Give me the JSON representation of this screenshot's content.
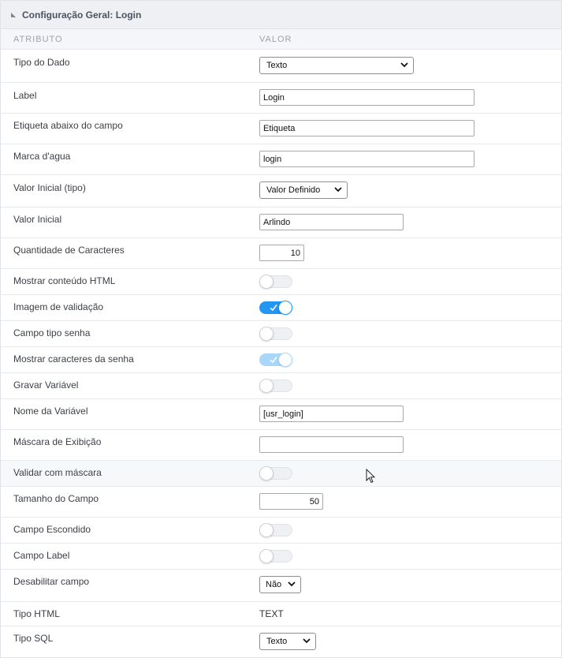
{
  "panel": {
    "title": "Configuração Geral: Login",
    "col_attr": "ATRIBUTO",
    "col_value": "VALOR"
  },
  "rows": {
    "tipo_dado": {
      "label": "Tipo do Dado",
      "value": "Texto"
    },
    "label": {
      "label": "Label",
      "value": "Login"
    },
    "etiqueta": {
      "label": "Etiqueta abaixo do campo",
      "value": "Etiqueta"
    },
    "marca": {
      "label": "Marca d'agua",
      "value": "login"
    },
    "valor_inicial_tipo": {
      "label": "Valor Inicial (tipo)",
      "value": "Valor Definido"
    },
    "valor_inicial": {
      "label": "Valor Inicial",
      "value": "Arlindo"
    },
    "qtd_caracteres": {
      "label": "Quantidade de Caracteres",
      "value": "10"
    },
    "mostrar_html": {
      "label": "Mostrar conteúdo HTML",
      "state": "off"
    },
    "imagem_validacao": {
      "label": "Imagem de validação",
      "state": "on"
    },
    "campo_senha": {
      "label": "Campo tipo senha",
      "state": "off"
    },
    "mostrar_caracteres": {
      "label": "Mostrar caracteres da senha",
      "state": "on-disabled"
    },
    "gravar_variavel": {
      "label": "Gravar Variável",
      "state": "off"
    },
    "nome_variavel": {
      "label": "Nome da Variável",
      "value": "[usr_login]"
    },
    "mascara_exibicao": {
      "label": "Máscara de Exibição",
      "value": ""
    },
    "validar_mascara": {
      "label": "Validar com máscara",
      "state": "off"
    },
    "tamanho_campo": {
      "label": "Tamanho do Campo",
      "value": "50"
    },
    "campo_escondido": {
      "label": "Campo Escondido",
      "state": "off"
    },
    "campo_label": {
      "label": "Campo Label",
      "state": "off"
    },
    "desabilitar": {
      "label": "Desabilitar campo",
      "value": "Não"
    },
    "tipo_html": {
      "label": "Tipo HTML",
      "value": "TEXT"
    },
    "tipo_sql": {
      "label": "Tipo SQL",
      "value": "Texto"
    }
  },
  "colors": {
    "toggle_on": "#2196f3",
    "toggle_disabled_on": "#a9d7fa",
    "toggle_off": "#eff0f3"
  }
}
